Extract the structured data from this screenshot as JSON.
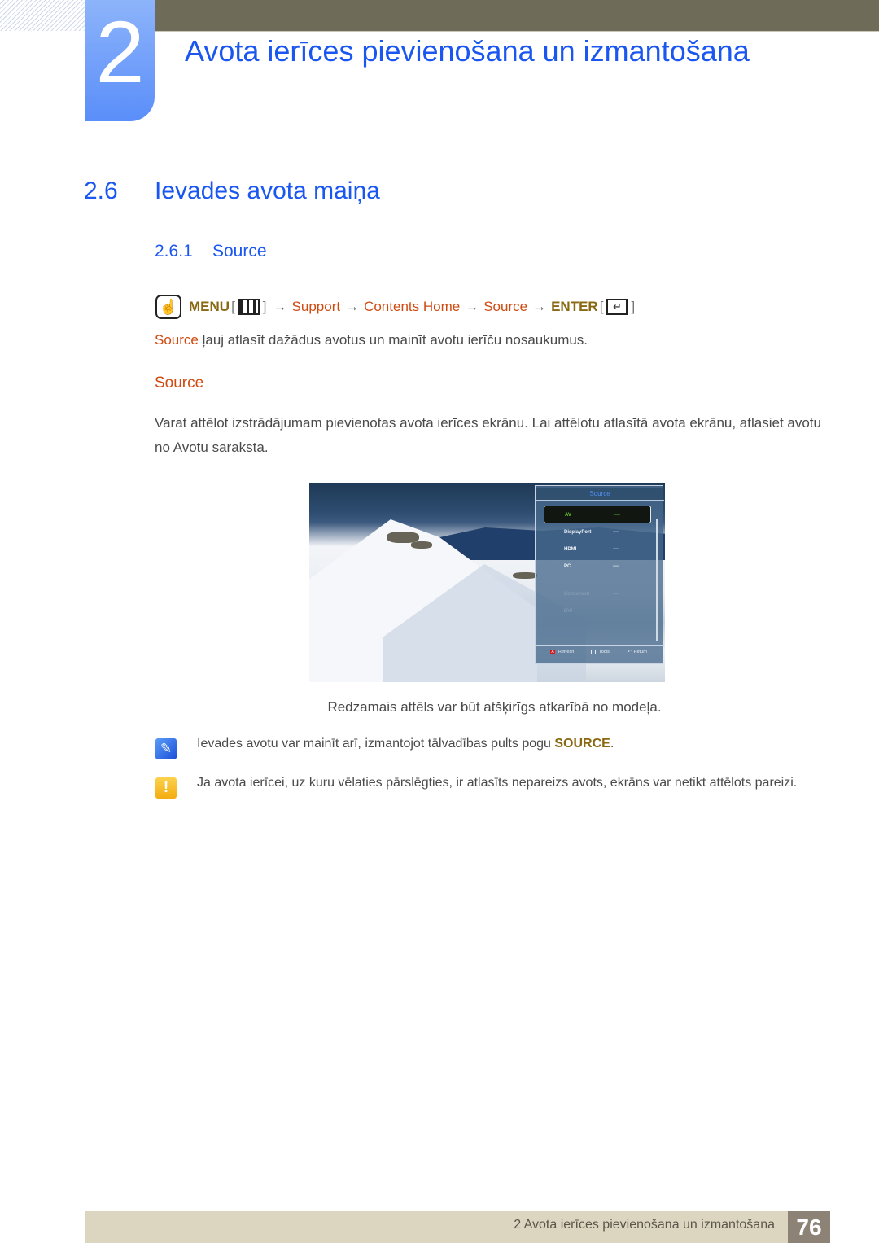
{
  "chapter": {
    "number": "2",
    "title": "Avota ierīces pievienošana un izmantošana"
  },
  "section": {
    "number": "2.6",
    "title": "Ievades avota maiņa"
  },
  "subsection": {
    "number": "2.6.1",
    "title": "Source"
  },
  "menu_path": {
    "hand_icon": "remote-touch-icon",
    "menu": "MENU",
    "menu_icon": "menu-grid-icon",
    "arrow": "→",
    "support": "Support",
    "contents_home": "Contents Home",
    "source": "Source",
    "enter": "ENTER",
    "enter_icon": "enter-return-icon",
    "open_bracket": "[",
    "close_bracket": "]"
  },
  "description": {
    "keyword": "Source",
    "text": " ļauj atlasīt dažādus avotus un mainīt avotu ierīču nosaukumus."
  },
  "source_heading": "Source",
  "paragraph": "Varat attēlot izstrādājumam pievienotas avota ierīces ekrānu. Lai attēlotu atlasītā avota ekrānu, atlasiet avotu no Avotu saraksta.",
  "figure": {
    "osd_title": "Source",
    "items": [
      {
        "label": "AV",
        "value": "----",
        "state": "selected"
      },
      {
        "label": "DisplayPort",
        "value": "----",
        "state": "normal"
      },
      {
        "label": "HDMI",
        "value": "----",
        "state": "normal"
      },
      {
        "label": "PC",
        "value": "----",
        "state": "normal"
      },
      {
        "label": "Component",
        "value": "----",
        "state": "disabled"
      },
      {
        "label": "DVI",
        "value": "----",
        "state": "disabled"
      }
    ],
    "footer": {
      "refresh_badge": "A",
      "refresh": "Refresh",
      "tools": "Tools",
      "return": "Return"
    },
    "caption": "Redzamais attēls var būt atšķirīgs atkarībā no modeļa."
  },
  "note": {
    "icon": "note-pencil-icon",
    "text": "Ievades avotu var mainīt arī, izmantojot tālvadības pults pogu ",
    "keyword": "SOURCE",
    "end": "."
  },
  "warning": {
    "icon": "warning-exclamation-icon",
    "glyph": "!",
    "text": "Ja avota ierīcei, uz kuru vēlaties pārslēgties, ir atlasīts nepareizs avots, ekrāns var netikt attēlots pareizi."
  },
  "footer": {
    "text": "2 Avota ierīces pievienošana un izmantošana",
    "page": "76"
  },
  "colors": {
    "heading_blue": "#1a56f0",
    "keyword_red": "#d04a10",
    "keyword_gold": "#8a6812",
    "top_bar": "#6e6b58",
    "footer_bg": "#dcd6c0",
    "page_badge": "#8d8276"
  }
}
